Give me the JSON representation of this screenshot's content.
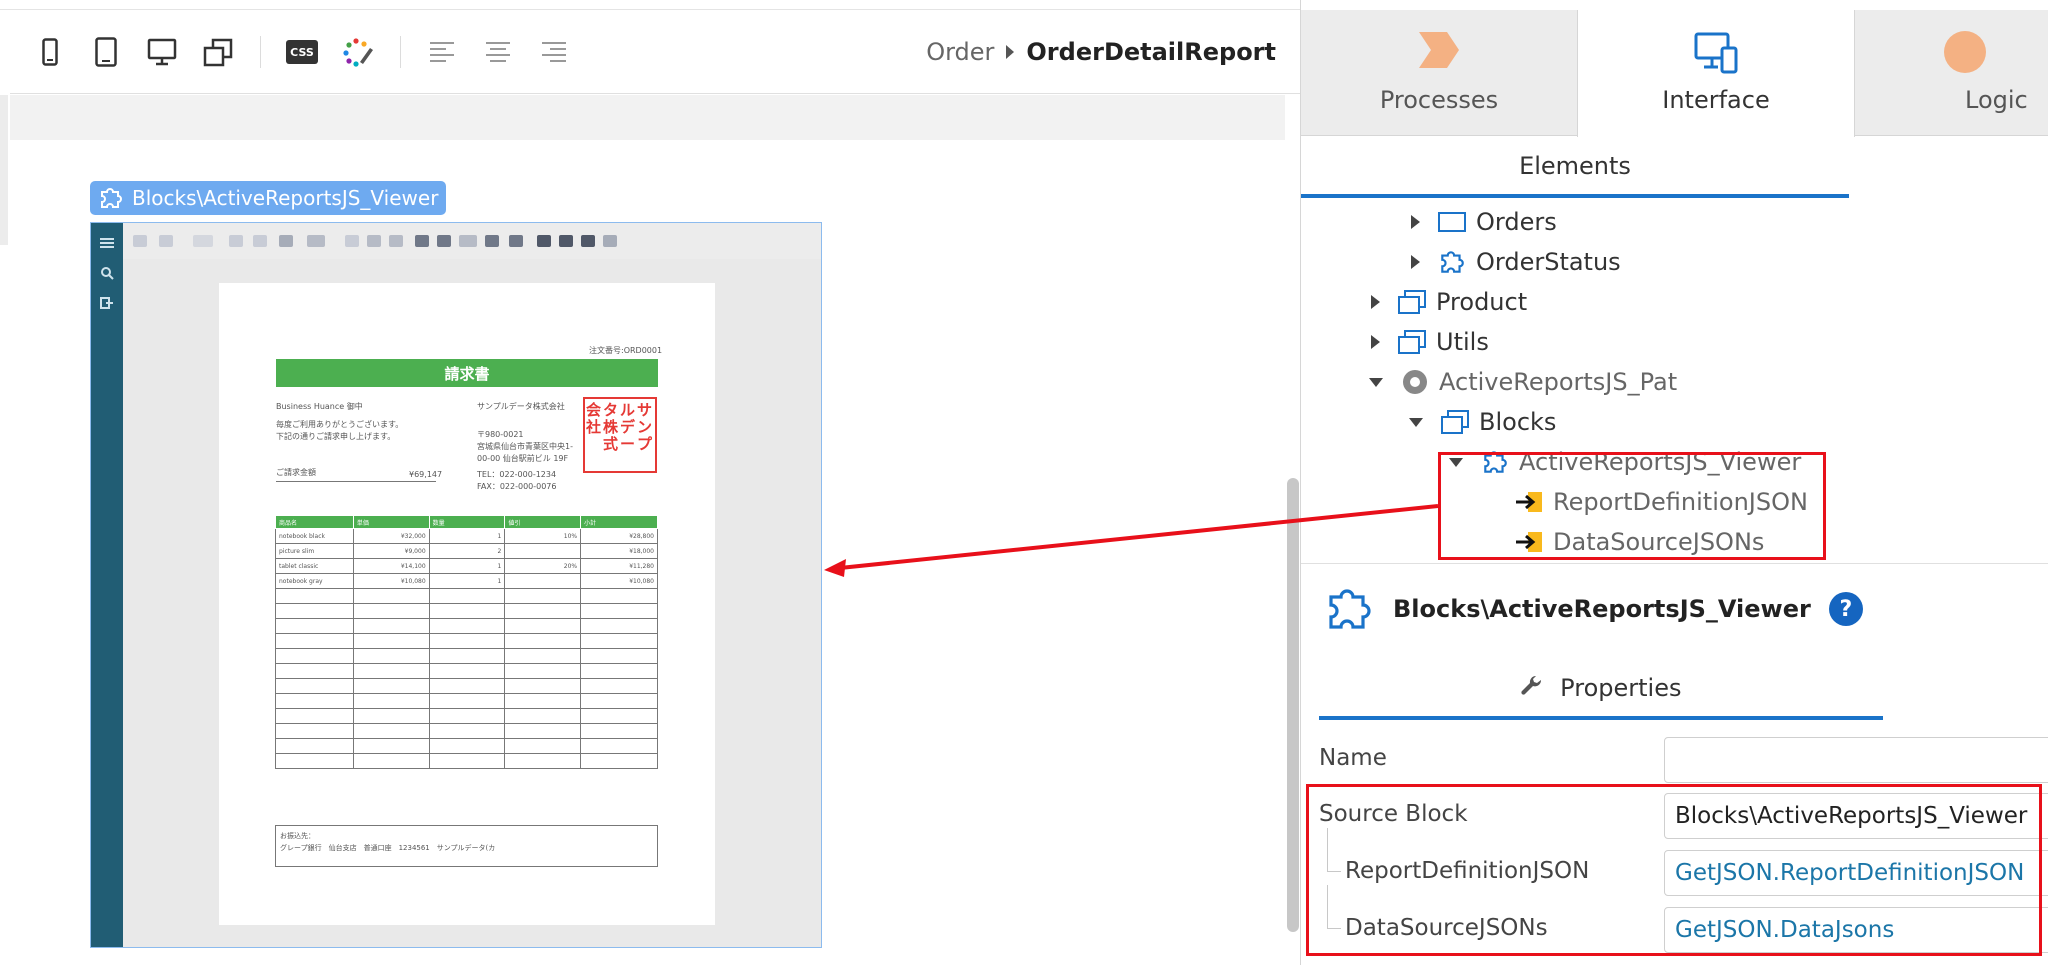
{
  "toolbar": {
    "icons": [
      "phone-icon",
      "tablet-icon",
      "desktop-icon",
      "rotate-icon",
      "css-icon",
      "theme-icon",
      "align-left-icon",
      "align-center-icon",
      "align-right-icon"
    ],
    "css_label": "CSS"
  },
  "breadcrumb": {
    "parent": "Order",
    "current": "OrderDetailReport"
  },
  "canvas": {
    "block_label": "Blocks\\ActiveReportsJS_Viewer",
    "report": {
      "order_no": "注文番号:ORD0001",
      "title": "請求書",
      "customer": "Business Huance 御中",
      "greeting1": "毎度ご利用ありがとうございます。",
      "greeting2": "下記の通りご請求申し上げます。",
      "total_label": "ご請求金額",
      "total_value": "¥69,147",
      "company": "サンプルデータ株式会社",
      "postal": "〒980-0021",
      "address1": "宮城県仙台市青葉区中央1-",
      "address2": "00-00 仙台駅前ビル 19F",
      "tel": "TEL：022-000-1234",
      "fax": "FAX：022-000-0076",
      "stamp_chars": [
        "サ",
        "ン",
        "プ",
        "ル",
        "デ",
        "ー",
        "タ",
        "株",
        "式",
        "会",
        "社"
      ],
      "table_headers": [
        "商品名",
        "単価",
        "数量",
        "値引",
        "小計"
      ],
      "rows": [
        [
          "notebook black",
          "¥32,000",
          "1",
          "10%",
          "¥28,800"
        ],
        [
          "picture slim",
          "¥9,000",
          "2",
          "",
          "¥18,000"
        ],
        [
          "tablet classic",
          "¥14,100",
          "1",
          "20%",
          "¥11,280"
        ],
        [
          "notebook gray",
          "¥10,080",
          "1",
          "",
          "¥10,080"
        ]
      ],
      "footer_label": "お振込先：",
      "footer_text": "グレープ銀行　仙台支店　普通口座　1234561　サンプルデータ(カ"
    }
  },
  "tabs": [
    {
      "label": "Processes",
      "icon": "processes-icon",
      "color": "#f4b183"
    },
    {
      "label": "Interface",
      "icon": "interface-icon",
      "color": "#1a73c9"
    },
    {
      "label": "Logic",
      "icon": "logic-icon",
      "color": "#f4b183"
    }
  ],
  "elements_tab": "Elements",
  "tree": [
    {
      "label": "Orders",
      "icon": "screen-icon",
      "toggle": "right"
    },
    {
      "label": "OrderStatus",
      "icon": "block-icon",
      "toggle": "right"
    },
    {
      "label": "Product",
      "icon": "flow-icon",
      "toggle": "right"
    },
    {
      "label": "Utils",
      "icon": "flow-icon",
      "toggle": "right"
    },
    {
      "label": "ActiveReportsJS_Pat",
      "icon": "module-icon",
      "toggle": "down"
    },
    {
      "label": "Blocks",
      "icon": "flow-icon",
      "toggle": "down"
    },
    {
      "label": "ActiveReportsJS_Viewer",
      "icon": "block-icon",
      "toggle": "down"
    },
    {
      "label": "ReportDefinitionJSON",
      "icon": "input-parameter-icon"
    },
    {
      "label": "DataSourceJSONs",
      "icon": "input-parameter-icon"
    }
  ],
  "block_header": {
    "title": "Blocks\\ActiveReportsJS_Viewer",
    "help": "?"
  },
  "properties_tab": "Properties",
  "properties": {
    "name_label": "Name",
    "name_value": "",
    "source_label": "Source Block",
    "source_value": "Blocks\\ActiveReportsJS_Viewer",
    "p1_label": "ReportDefinitionJSON",
    "p1_value": "GetJSON.ReportDefinitionJSON",
    "p2_label": "DataSourceJSONs",
    "p2_value": "GetJSON.DataJsons"
  },
  "colors": {
    "accent": "#1a73c9",
    "highlight": "#e8101a",
    "sidebar": "#215d74",
    "report_green": "#4caf50"
  }
}
